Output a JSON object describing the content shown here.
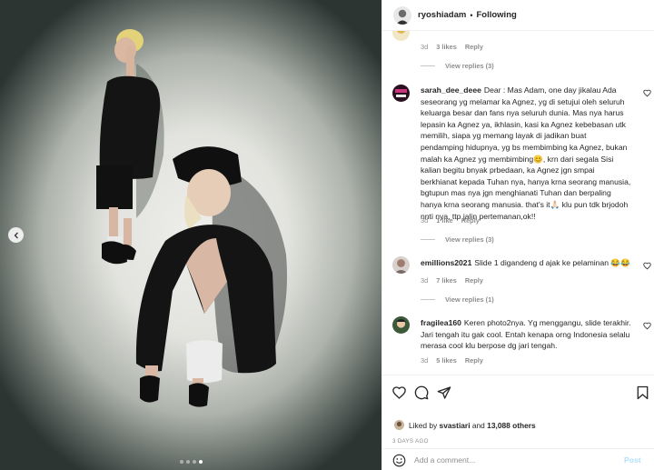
{
  "header": {
    "username": "ryoshiadam",
    "separator": "•",
    "follow_status": "Following"
  },
  "comments": [
    {
      "user": "",
      "text": "",
      "time": "3d",
      "likes": "3 likes",
      "reply": "Reply",
      "view_replies": "View replies (3)"
    },
    {
      "user": "sarah_dee_deee",
      "text": "Dear : Mas Adam, one day jikalau Ada seseorang yg melamar ka Agnez, yg di setujui oleh seluruh keluarga besar dan fans nya seluruh dunia. Mas nya harus lepasin ka Agnez ya, ikhlasin, kasi ka Agnez kebebasan utk memilih, siapa yg memang layak di jadikan buat pendamping hidupnya, yg bs membimbing ka Agnez, bukan malah ka Agnez yg membimbing😊, krn dari segala Sisi kalian begitu bnyak prbedaan, ka Agnez jgn smpai berkhianat kepada Tuhan nya, hanya krna seorang manusia, bgtupun mas nya jgn menghianati Tuhan dan berpaling hanya krna seorang manusia. that's it🙏🏻 klu pun tdk brjodoh nnti nya, ttp jalin pertemanan,ok!!",
      "time": "3d",
      "likes": "1 like",
      "reply": "Reply",
      "view_replies": "View replies (3)"
    },
    {
      "user": "emillions2021",
      "text": "Slide 1 digandeng d ajak ke pelaminan 😂😂",
      "time": "3d",
      "likes": "7 likes",
      "reply": "Reply",
      "view_replies": "View replies (1)"
    },
    {
      "user": "fragilea160",
      "text": "Keren photo2nya. Yg menggangu, slide terakhir. Jari tengah itu gak cool. Entah kenapa orng Indonesia selalu merasa cool klu berpose dg jari tengah.",
      "time": "3d",
      "likes": "5 likes",
      "reply": "Reply",
      "view_replies": ""
    }
  ],
  "likes": {
    "prefix": "Liked by",
    "user": "svastiari",
    "and": "and",
    "count": "13,088 others"
  },
  "post_time": "3 DAYS AGO",
  "add_comment": {
    "placeholder": "Add a comment...",
    "post_label": "Post"
  },
  "carousel": {
    "slide_count": 4,
    "active_slide": 4
  },
  "colors": {
    "accent_disabled": "#b2dffc",
    "meta_gray": "#8e8e8e",
    "text": "#262626"
  }
}
